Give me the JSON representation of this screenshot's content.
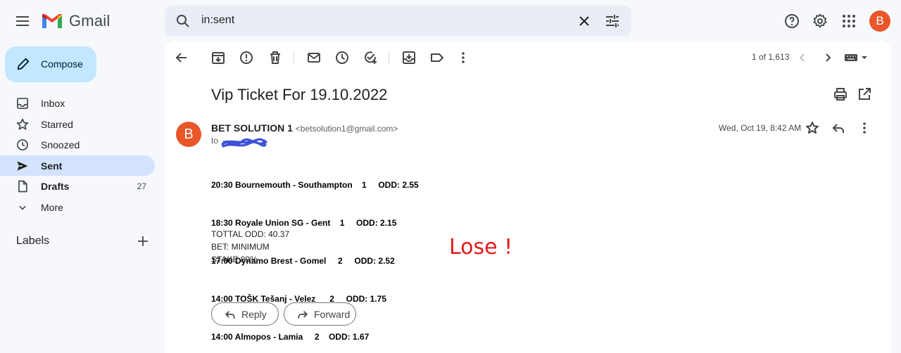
{
  "app": {
    "name": "Gmail"
  },
  "search": {
    "value": "in:sent"
  },
  "account": {
    "avatar_letter": "B",
    "color": "#e8562a"
  },
  "compose": {
    "label": "Compose"
  },
  "nav": [
    {
      "label": "Inbox",
      "icon": "inbox-icon",
      "count": ""
    },
    {
      "label": "Starred",
      "icon": "star-icon",
      "count": ""
    },
    {
      "label": "Snoozed",
      "icon": "clock-icon",
      "count": ""
    },
    {
      "label": "Sent",
      "icon": "send-icon",
      "count": "",
      "active": true
    },
    {
      "label": "Drafts",
      "icon": "draft-icon",
      "count": "27"
    },
    {
      "label": "More",
      "icon": "chevron-down-icon",
      "count": ""
    }
  ],
  "labels": {
    "heading": "Labels"
  },
  "toolbar": {
    "pagination": "1 of 1,613"
  },
  "email": {
    "subject": "Vip Ticket For 19.10.2022",
    "avatar_letter": "B",
    "sender_name": "BET SOLUTION 1",
    "sender_email": "<betsolution1@gmail.com>",
    "to_label": "to",
    "date": "Wed, Oct 19, 8:42 AM",
    "picks": [
      "20:30 Bournemouth - Southampton    1     ODD: 2.55",
      "18:30 Royale Union SG - Gent    1     ODD: 2.15",
      "17:00 Dynamo Brest - Gomel     2     ODD: 2.52",
      "14:00 TOŠK Tešanj - Velez      2     ODD: 1.75",
      "14:00 Almopos - Lamia     2    ODD: 1.67"
    ],
    "total_odd": "TOTTAL ODD: 40.37",
    "bet": "BET: MINIMUM",
    "stake": "STAKE 89%",
    "overlay": "Lose !"
  },
  "actions": {
    "reply": "Reply",
    "forward": "Forward"
  }
}
